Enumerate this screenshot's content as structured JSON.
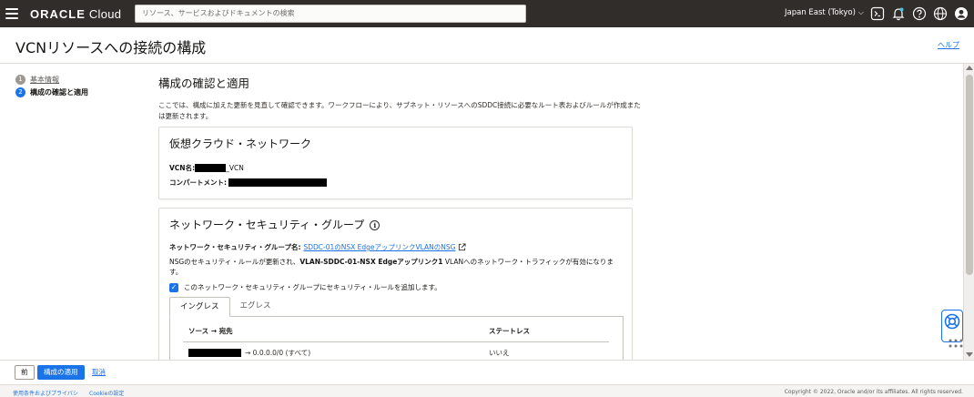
{
  "topbar": {
    "brand": "ORACLE",
    "product": "Cloud",
    "search_placeholder": "リソース、サービスおよびドキュメントの検索",
    "region": "Japan East (Tokyo)"
  },
  "header": {
    "title": "VCNリソースへの接続の構成",
    "help": "ヘルプ"
  },
  "steps": [
    {
      "num": "1",
      "label": "基本情報"
    },
    {
      "num": "2",
      "label": "構成の確認と適用"
    }
  ],
  "main": {
    "title": "構成の確認と適用",
    "intro": "ここでは、構成に加えた更新を見直して確認できます。ワークフローにより、サブネット・リソースへのSDDC接続に必要なルート表およびルールが作成または更新されます。"
  },
  "vcn_card": {
    "title": "仮想クラウド・ネットワーク",
    "vcn_name_label": "VCN名:",
    "vcn_name_suffix": "_VCN",
    "compartment_label": "コンパートメント:"
  },
  "nsg_card": {
    "title": "ネットワーク・セキュリティ・グループ",
    "group_name_label": "ネットワーク・セキュリティ・グループ名:",
    "group_name_link": "SDDC-01のNSX EdgeアップリンクVLANのNSG",
    "desc_part1": "NSGのセキュリティ・ルールが更新され、",
    "desc_bold": "VLAN-SDDC-01-NSX Edgeアップリンク1",
    "desc_part2": " VLANへのネットワーク・トラフィックが有効になります。",
    "checkbox_label": "このネットワーク・セキュリティ・グループにセキュリティ・ルールを追加します。",
    "tabs": [
      "イングレス",
      "エグレス"
    ],
    "table": {
      "col_source": "ソース → 宛先",
      "col_state": "ステートレス",
      "row1_dest": "→ 0.0.0.0/0 (すべて)",
      "row1_state": "いいえ"
    }
  },
  "actions": {
    "prev": "前",
    "apply": "構成の適用",
    "cancel": "取消"
  },
  "footer": {
    "terms": "使用条件およびプライバシ",
    "cookie": "Cookieの設定",
    "copyright": "Copyright © 2022, Oracle and/or its affiliates. All rights reserved."
  },
  "colors": {
    "topbar": "#312d2a",
    "accent": "#1a73e8"
  }
}
